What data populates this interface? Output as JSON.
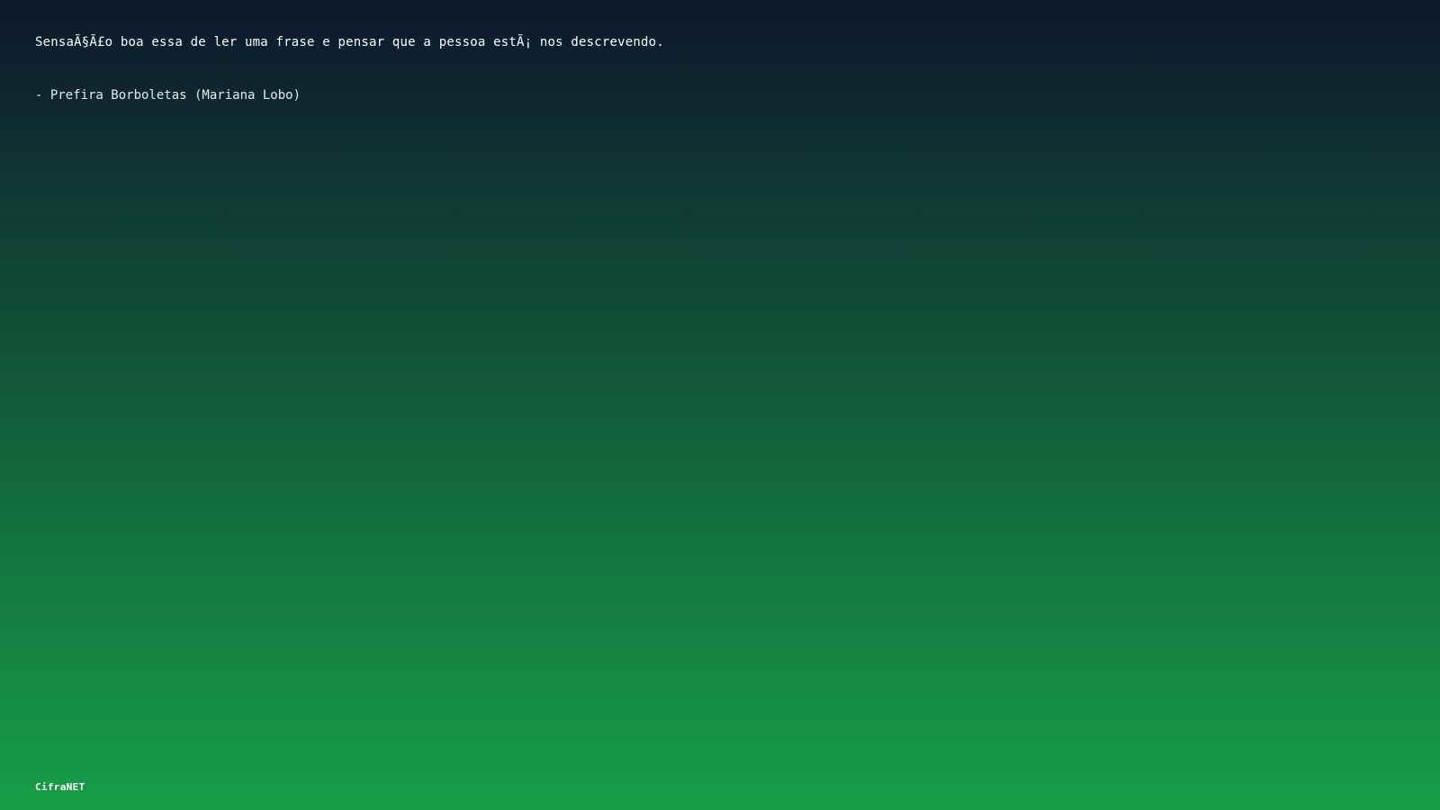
{
  "quote": {
    "text": "SensaÃ§Ã£o boa essa de ler uma frase e pensar que a pessoa estÃ¡ nos descrevendo.",
    "author": "- Prefira Borboletas (Mariana Lobo)"
  },
  "brand": {
    "name": "CifraNET"
  },
  "colors": {
    "gradient_top": "#0e172c",
    "gradient_bottom": "#169e47",
    "text": "#ffffff"
  }
}
